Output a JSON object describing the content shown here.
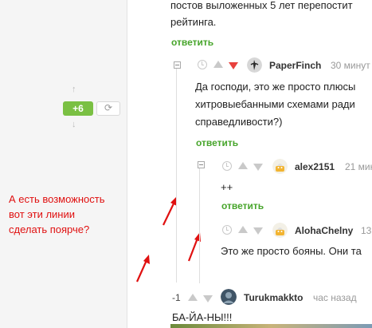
{
  "sidebar": {
    "rating": "+6",
    "up_arrow": "↑",
    "down_arrow": "↓",
    "refresh_icon": "⟳",
    "accent": "#7ac043"
  },
  "annotation": {
    "lines": [
      "А есть возможность",
      "вот эти линии",
      "сделать пoярче?"
    ],
    "color": "#e01010"
  },
  "comments": {
    "top": {
      "text_lines": [
        "постов выложенных 5 лет перепостит",
        "рейтинга."
      ],
      "reply": "ответить"
    },
    "paperfinch": {
      "username": "PaperFinch",
      "time": "30 минут",
      "text_lines": [
        "Да господи, это же просто плюсы",
        "хитровыебанными схемами ради",
        "справедливости?)"
      ],
      "reply": "ответить"
    },
    "alex": {
      "username": "alex2151",
      "time": "21 мин",
      "text": "++",
      "reply": "ответить"
    },
    "aloha": {
      "username": "AlohaChelny",
      "time": "13",
      "text": "Это же просто бояны. Они та"
    },
    "turuk": {
      "score": "-1",
      "username": "Turukmakkto",
      "time": "час назад",
      "text": "БА-ЙА-НЫ!!!"
    }
  },
  "colors": {
    "reply_link": "#47a52b",
    "downvote_active": "#e8413d",
    "thread_line": "#dedede"
  }
}
